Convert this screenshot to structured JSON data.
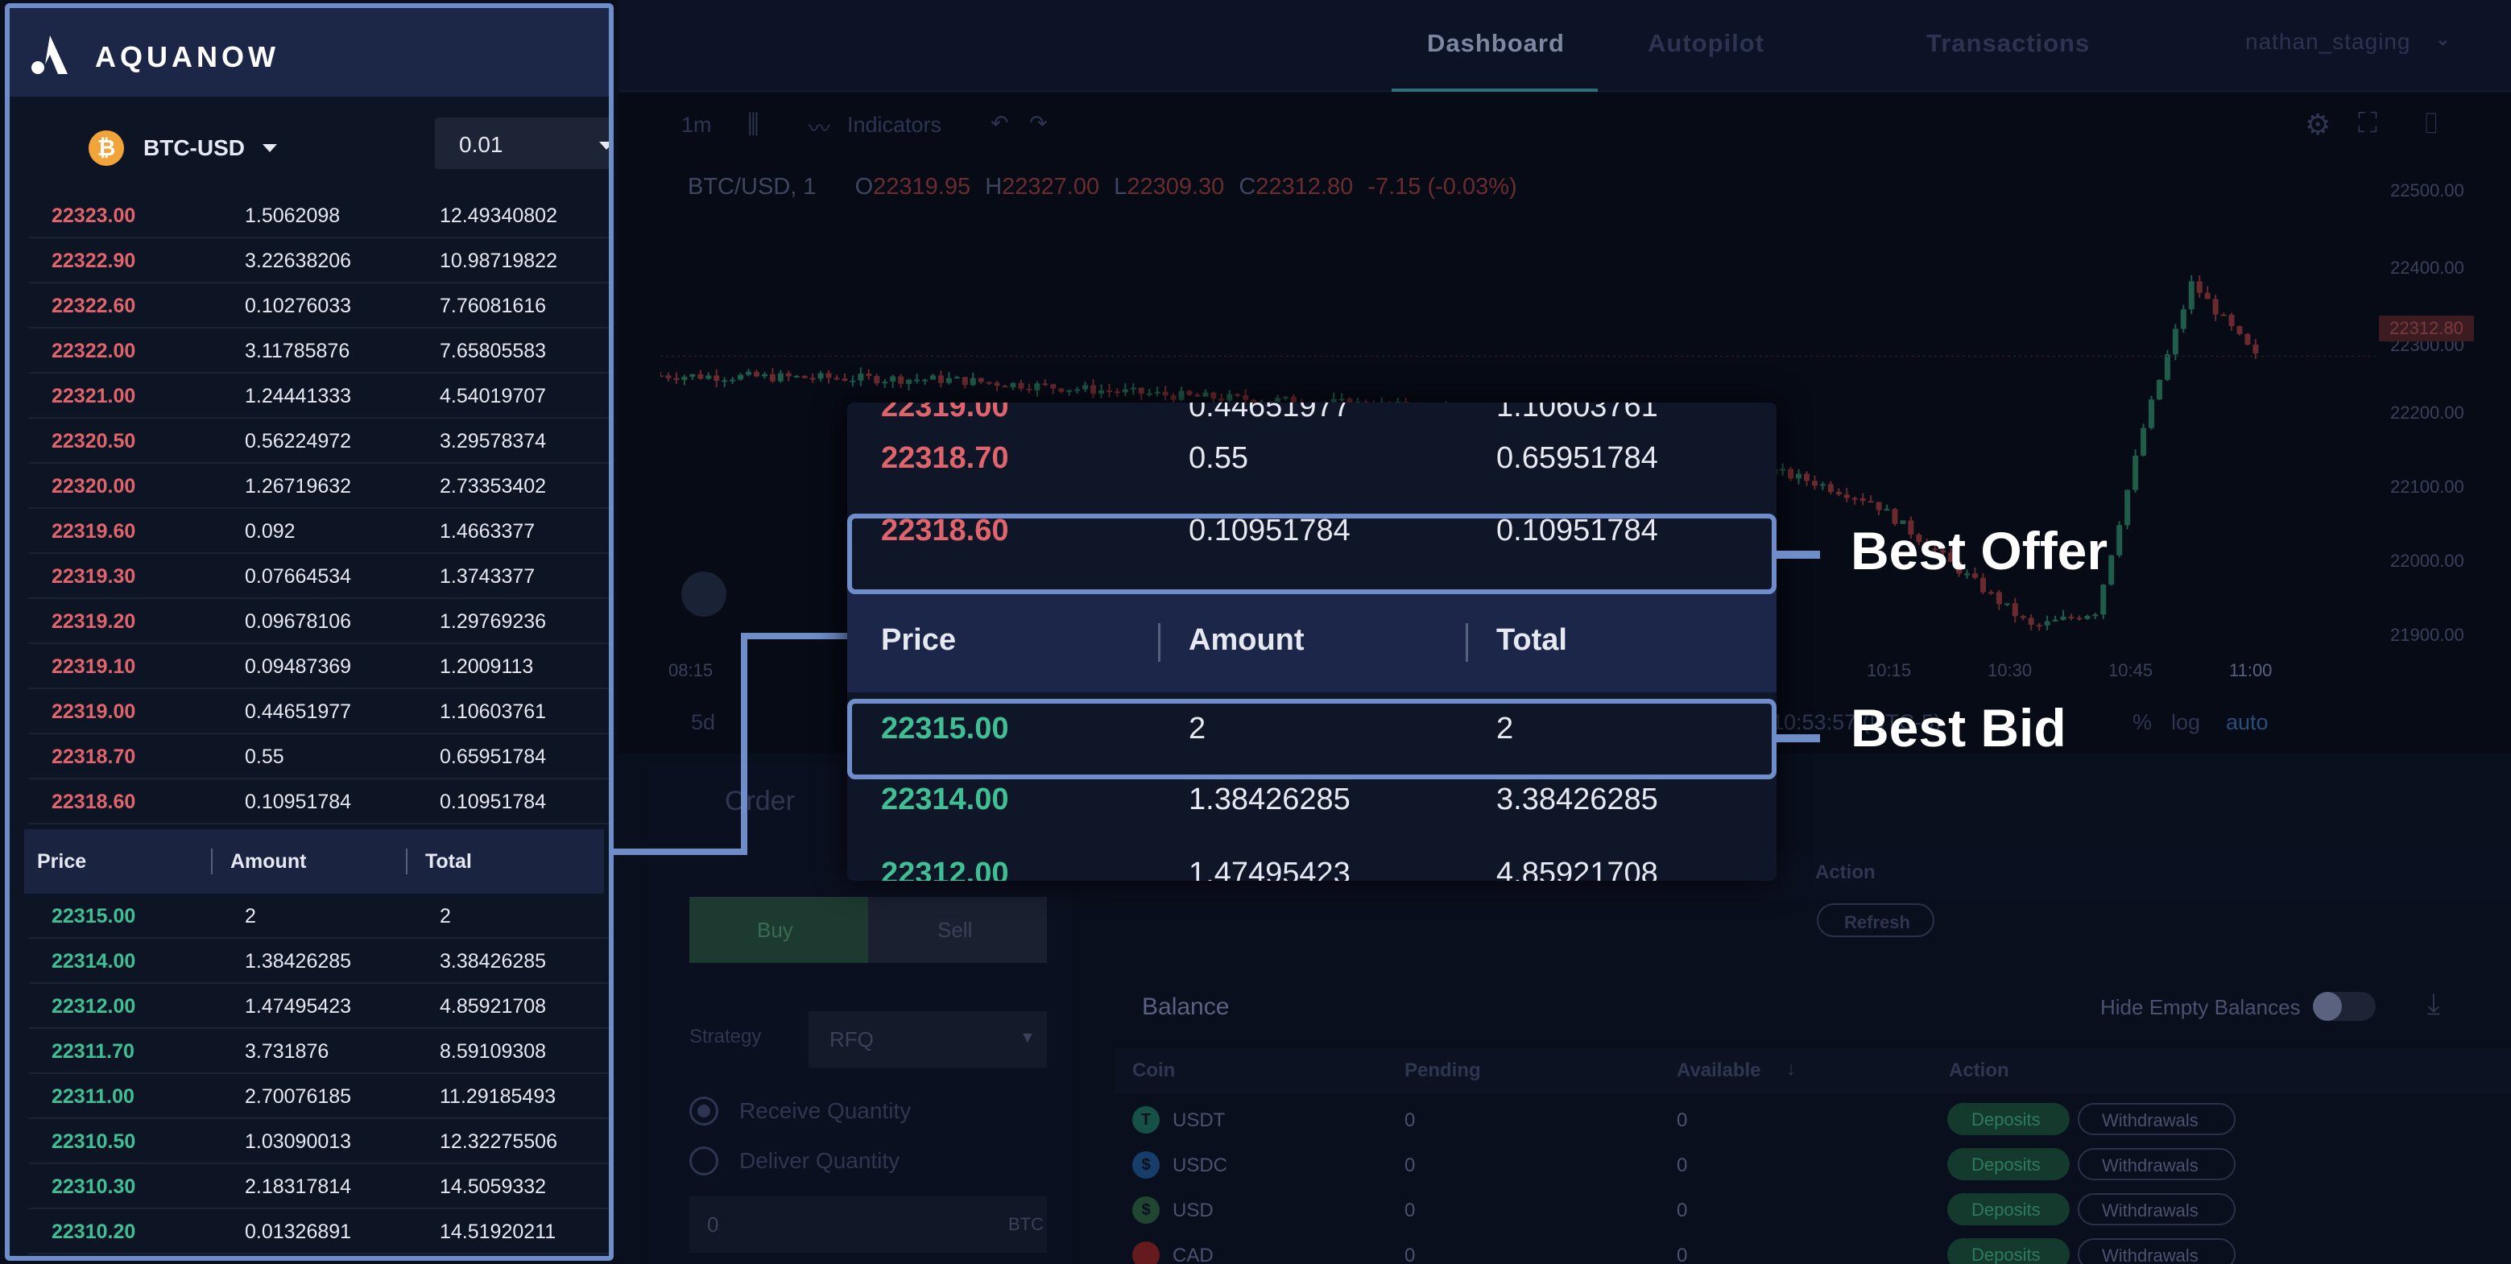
{
  "brand": {
    "name": "AQUANOW"
  },
  "nav": {
    "tabs": [
      "Dashboard",
      "Autopilot",
      "Transactions"
    ],
    "active": "Dashboard",
    "user": "nathan_staging"
  },
  "chart_toolbar": {
    "interval": "1m",
    "indicators_label": "Indicators"
  },
  "chart_header": {
    "symbol": "BTC/USD, 1",
    "open_prefix": "O",
    "open": "22319.95",
    "high_prefix": "H",
    "high": "22327.00",
    "low_prefix": "L",
    "low": "22309.30",
    "close_prefix": "C",
    "close": "22312.80",
    "change": "-7.15 (-0.03%)"
  },
  "chart_axes": {
    "y_ticks": [
      "22500.00",
      "22400.00",
      "22300.00",
      "22200.00",
      "22100.00",
      "22000.00",
      "21900.00"
    ],
    "x_ticks": [
      "08:15",
      "10:15",
      "10:30",
      "10:45",
      "11:00"
    ],
    "last_price_tag": "22312.80"
  },
  "chart_footer": {
    "range_label": "5d",
    "time": "10:53:57 (UTC-5)",
    "percent": "%",
    "log": "log",
    "auto": "auto"
  },
  "order_panel": {
    "tab": "Order",
    "buy_label": "Buy",
    "sell_label": "Sell",
    "strategy_label": "Strategy",
    "strategy_value": "RFQ",
    "receive_label": "Receive Quantity",
    "deliver_label": "Deliver Quantity",
    "amount_value": "0",
    "amount_unit": "BTC"
  },
  "orders_table": {
    "action_header": "Action",
    "refresh_label": "Refresh"
  },
  "balance": {
    "title": "Balance",
    "hide_empty_label": "Hide Empty Balances",
    "columns": [
      "Coin",
      "Pending",
      "Available",
      "Action"
    ],
    "rows": [
      {
        "coin": "USDT",
        "icon": "tether-icon",
        "icon_glyph": "T",
        "color": "#26a17b",
        "pending": "0",
        "available": "0"
      },
      {
        "coin": "USDC",
        "icon": "usdc-icon",
        "icon_glyph": "$",
        "color": "#2775ca",
        "pending": "0",
        "available": "0"
      },
      {
        "coin": "USD",
        "icon": "usd-icon",
        "icon_glyph": "$",
        "color": "#3b8a4a",
        "pending": "0",
        "available": "0"
      },
      {
        "coin": "CAD",
        "icon": "cad-flag-icon",
        "icon_glyph": "",
        "color": "#d52b1e",
        "pending": "0",
        "available": "0"
      }
    ],
    "deposit_label": "Deposits",
    "withdraw_label": "Withdrawals"
  },
  "orderbook": {
    "pair": "BTC-USD",
    "size": "0.01",
    "columns": [
      "Price",
      "Amount",
      "Total"
    ],
    "asks": [
      [
        "22323.00",
        "1.5062098",
        "12.49340802"
      ],
      [
        "22322.90",
        "3.22638206",
        "10.98719822"
      ],
      [
        "22322.60",
        "0.10276033",
        "7.76081616"
      ],
      [
        "22322.00",
        "3.11785876",
        "7.65805583"
      ],
      [
        "22321.00",
        "1.24441333",
        "4.54019707"
      ],
      [
        "22320.50",
        "0.56224972",
        "3.29578374"
      ],
      [
        "22320.00",
        "1.26719632",
        "2.73353402"
      ],
      [
        "22319.60",
        "0.092",
        "1.4663377"
      ],
      [
        "22319.30",
        "0.07664534",
        "1.3743377"
      ],
      [
        "22319.20",
        "0.09678106",
        "1.29769236"
      ],
      [
        "22319.10",
        "0.09487369",
        "1.2009113"
      ],
      [
        "22319.00",
        "0.44651977",
        "1.10603761"
      ],
      [
        "22318.70",
        "0.55",
        "0.65951784"
      ],
      [
        "22318.60",
        "0.10951784",
        "0.10951784"
      ]
    ],
    "bids": [
      [
        "22315.00",
        "2",
        "2"
      ],
      [
        "22314.00",
        "1.38426285",
        "3.38426285"
      ],
      [
        "22312.00",
        "1.47495423",
        "4.85921708"
      ],
      [
        "22311.70",
        "3.731876",
        "8.59109308"
      ],
      [
        "22311.00",
        "2.70076185",
        "11.29185493"
      ],
      [
        "22310.50",
        "1.03090013",
        "12.32275506"
      ],
      [
        "22310.30",
        "2.18317814",
        "14.5059332"
      ],
      [
        "22310.20",
        "0.01326891",
        "14.51920211"
      ]
    ]
  },
  "zoom": {
    "asks": [
      [
        "22319.00",
        "0.44651977",
        "1.10603761"
      ],
      [
        "22318.70",
        "0.55",
        "0.65951784"
      ],
      [
        "22318.60",
        "0.10951784",
        "0.10951784"
      ]
    ],
    "bids": [
      [
        "22315.00",
        "2",
        "2"
      ],
      [
        "22314.00",
        "1.38426285",
        "3.38426285"
      ],
      [
        "22312.00",
        "1.47495423",
        "4.85921708"
      ]
    ],
    "best_offer_label": "Best Offer",
    "best_bid_label": "Best Bid"
  },
  "colors": {
    "ask": "#e0646b",
    "bid": "#3fbf93",
    "highlight": "#6f8ec9"
  }
}
